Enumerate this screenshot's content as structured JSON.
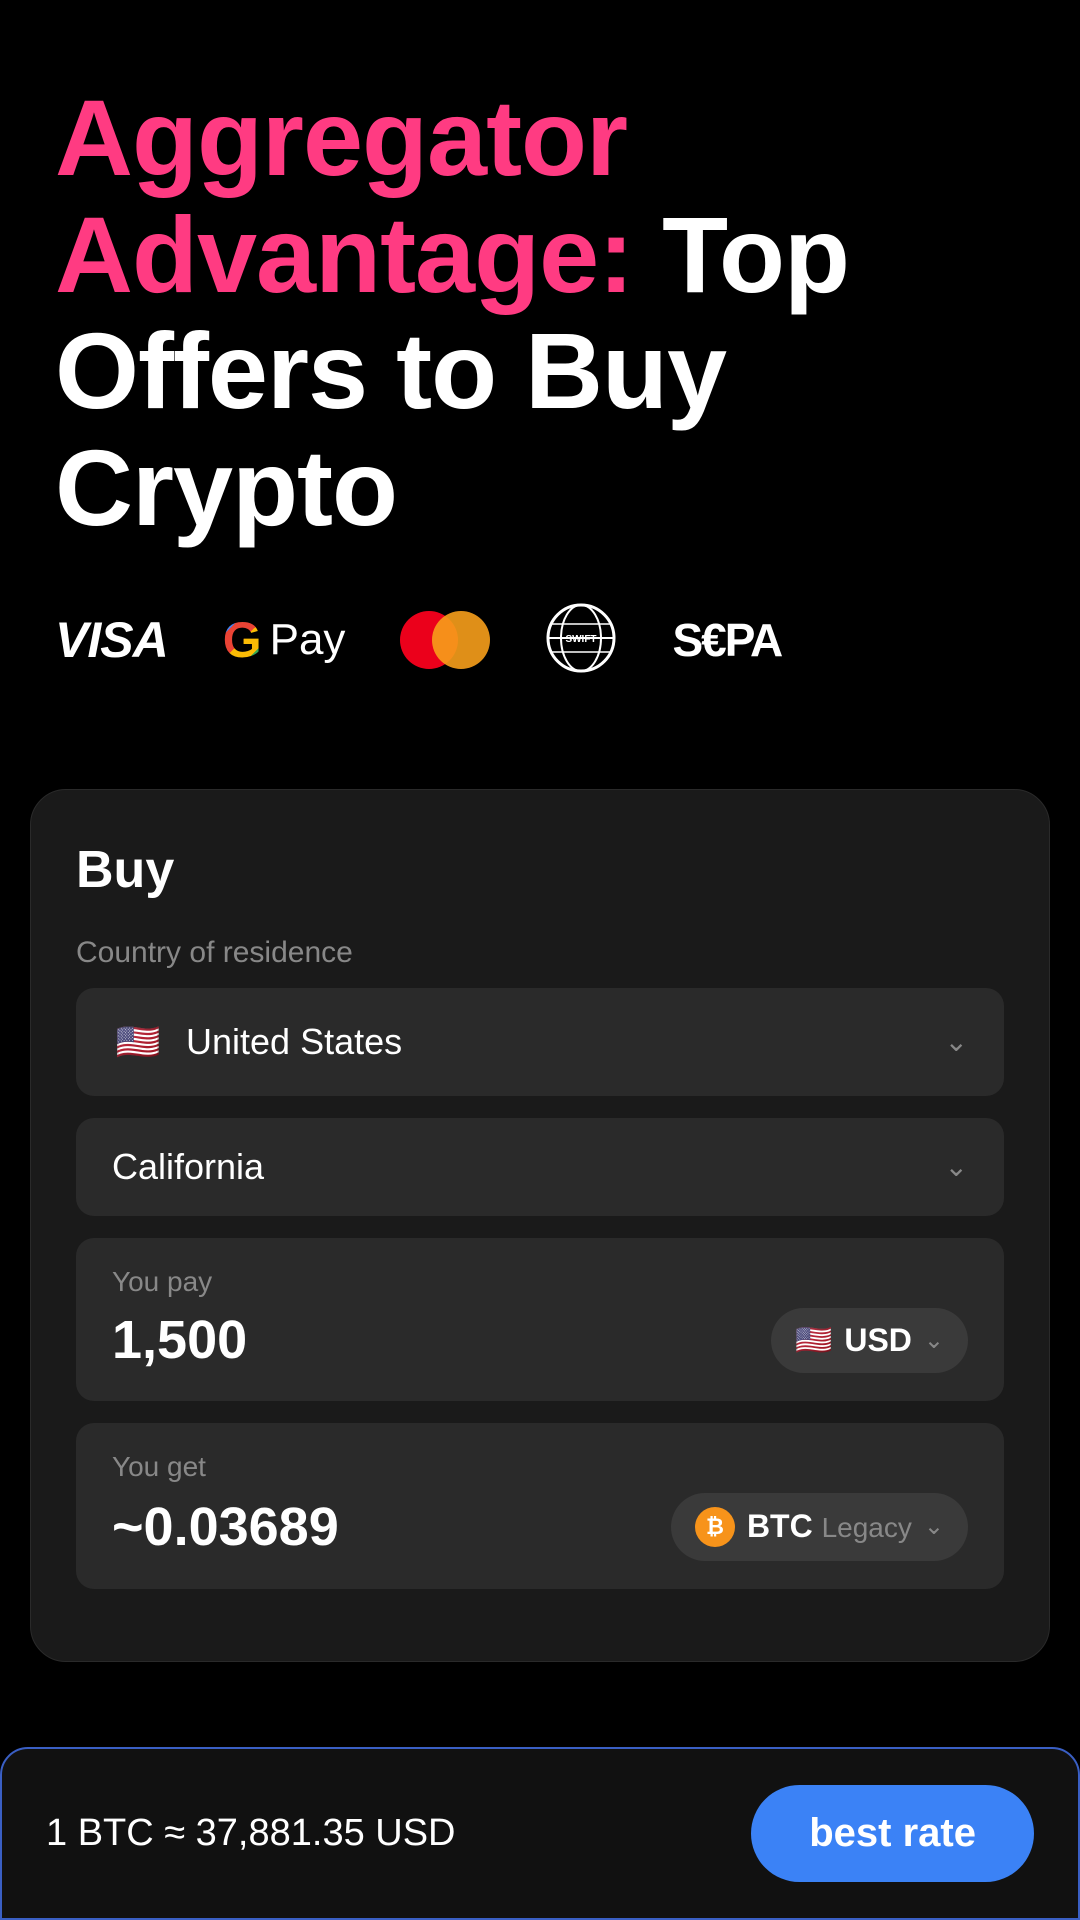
{
  "hero": {
    "title_pink": "Aggregator Advantage:",
    "title_white": " Top Offers to Buy Crypto"
  },
  "payment_methods": [
    {
      "id": "visa",
      "label": "VISA"
    },
    {
      "id": "gpay",
      "label": "G Pay"
    },
    {
      "id": "mastercard",
      "label": "Mastercard"
    },
    {
      "id": "swift",
      "label": "SWIFT"
    },
    {
      "id": "sepa",
      "label": "S€PA"
    }
  ],
  "card": {
    "title": "Buy",
    "country_label": "Country of residence",
    "country_value": "United States",
    "state_value": "California",
    "you_pay_label": "You pay",
    "you_pay_value": "1,500",
    "pay_currency": "USD",
    "you_get_label": "You get",
    "you_get_value": "~0.03689",
    "get_currency": "BTC Legacy"
  },
  "bottom_bar": {
    "rate_text": "1 BTC ≈ 37,881.35 USD",
    "button_label": "best rate"
  },
  "icons": {
    "chevron": "⌄",
    "flag_us": "🇺🇸"
  }
}
